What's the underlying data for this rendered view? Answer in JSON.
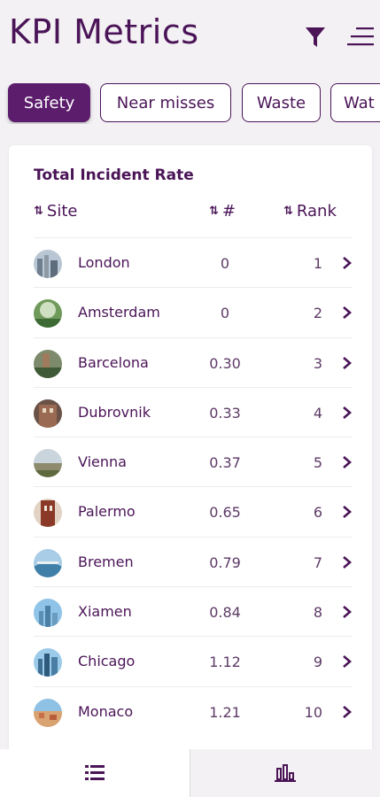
{
  "header": {
    "title": "KPI Metrics"
  },
  "chips": [
    {
      "label": "Safety",
      "active": true
    },
    {
      "label": "Near misses",
      "active": false
    },
    {
      "label": "Waste",
      "active": false
    },
    {
      "label": "Wat",
      "active": false
    }
  ],
  "card": {
    "title": "Total Incident Rate",
    "columns": {
      "site": "Site",
      "num": "#",
      "rank": "Rank"
    },
    "rows": [
      {
        "site": "London",
        "num": "0",
        "rank": "1"
      },
      {
        "site": "Amsterdam",
        "num": "0",
        "rank": "2"
      },
      {
        "site": "Barcelona",
        "num": "0.30",
        "rank": "3"
      },
      {
        "site": "Dubrovnik",
        "num": "0.33",
        "rank": "4"
      },
      {
        "site": "Vienna",
        "num": "0.37",
        "rank": "5"
      },
      {
        "site": "Palermo",
        "num": "0.65",
        "rank": "6"
      },
      {
        "site": "Bremen",
        "num": "0.79",
        "rank": "7"
      },
      {
        "site": "Xiamen",
        "num": "0.84",
        "rank": "8"
      },
      {
        "site": "Chicago",
        "num": "1.12",
        "rank": "9"
      },
      {
        "site": "Monaco",
        "num": "1.21",
        "rank": "10"
      }
    ]
  },
  "tabbar": {
    "items": [
      {
        "icon": "list-icon",
        "active": true
      },
      {
        "icon": "bar-chart-icon",
        "active": false
      }
    ]
  },
  "colors": {
    "primary": "#5c1d6c",
    "text": "#4a1457",
    "background": "#f3f1f4"
  }
}
